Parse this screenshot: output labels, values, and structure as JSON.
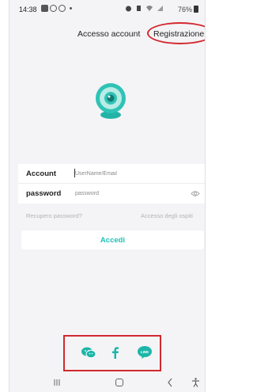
{
  "status_bar": {
    "time": "14:38",
    "battery": "76%"
  },
  "header": {
    "title": "Accesso account",
    "register_link": "Registrazione"
  },
  "form": {
    "account_label": "Account",
    "account_placeholder": "UserName/Email",
    "password_label": "password",
    "password_placeholder": "password"
  },
  "links": {
    "recover_password": "Recupero password?",
    "guest_access": "Accesso degli ospiti"
  },
  "login_button": "Accedi",
  "social_login": [
    "wechat-icon",
    "facebook-icon",
    "line-icon"
  ],
  "line_icon_text": "LINE",
  "colors": {
    "accent": "#1ec2b8",
    "highlight": "#d2282e",
    "wechat": "#1db6a9",
    "facebook": "#1db6a9",
    "line": "#1db6a9"
  }
}
